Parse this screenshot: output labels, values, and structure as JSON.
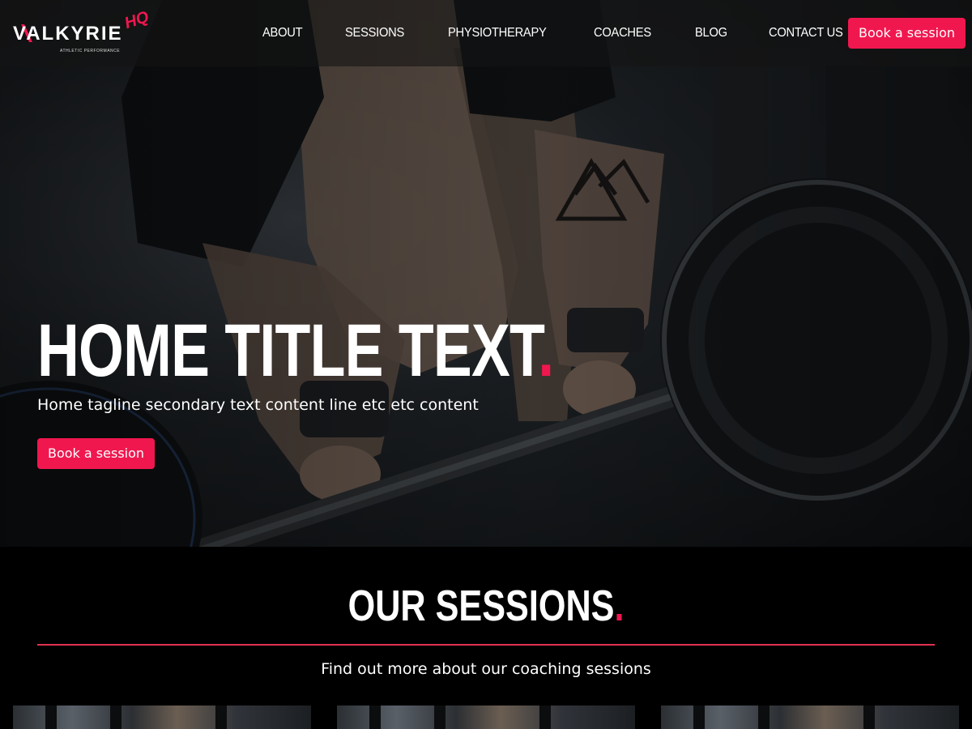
{
  "brand": {
    "name": "VALKYRIE",
    "badge": "HQ",
    "subtitle": "ATHLETIC PERFORMANCE",
    "accent_color": "#f0174f"
  },
  "nav": {
    "items": [
      "ABOUT",
      "SESSIONS",
      "PHYSIOTHERAPY",
      "COACHES",
      "BLOG",
      "CONTACT US"
    ],
    "cta_label": "Book a session"
  },
  "hero": {
    "title": "HOME TITLE TEXT",
    "title_dot": ".",
    "tagline": "Home tagline secondary text content line etc etc content",
    "cta_label": "Book a session",
    "background": "photo of athlete gripping a barbell in a gym"
  },
  "sessions": {
    "title": "OUR SESSIONS",
    "title_dot": ".",
    "subtitle": "Find out more about our coaching sessions",
    "cards": [
      {
        "image": "barbell-deadlift-photo"
      },
      {
        "image": "barbell-deadlift-photo"
      },
      {
        "image": "barbell-deadlift-photo"
      }
    ]
  }
}
